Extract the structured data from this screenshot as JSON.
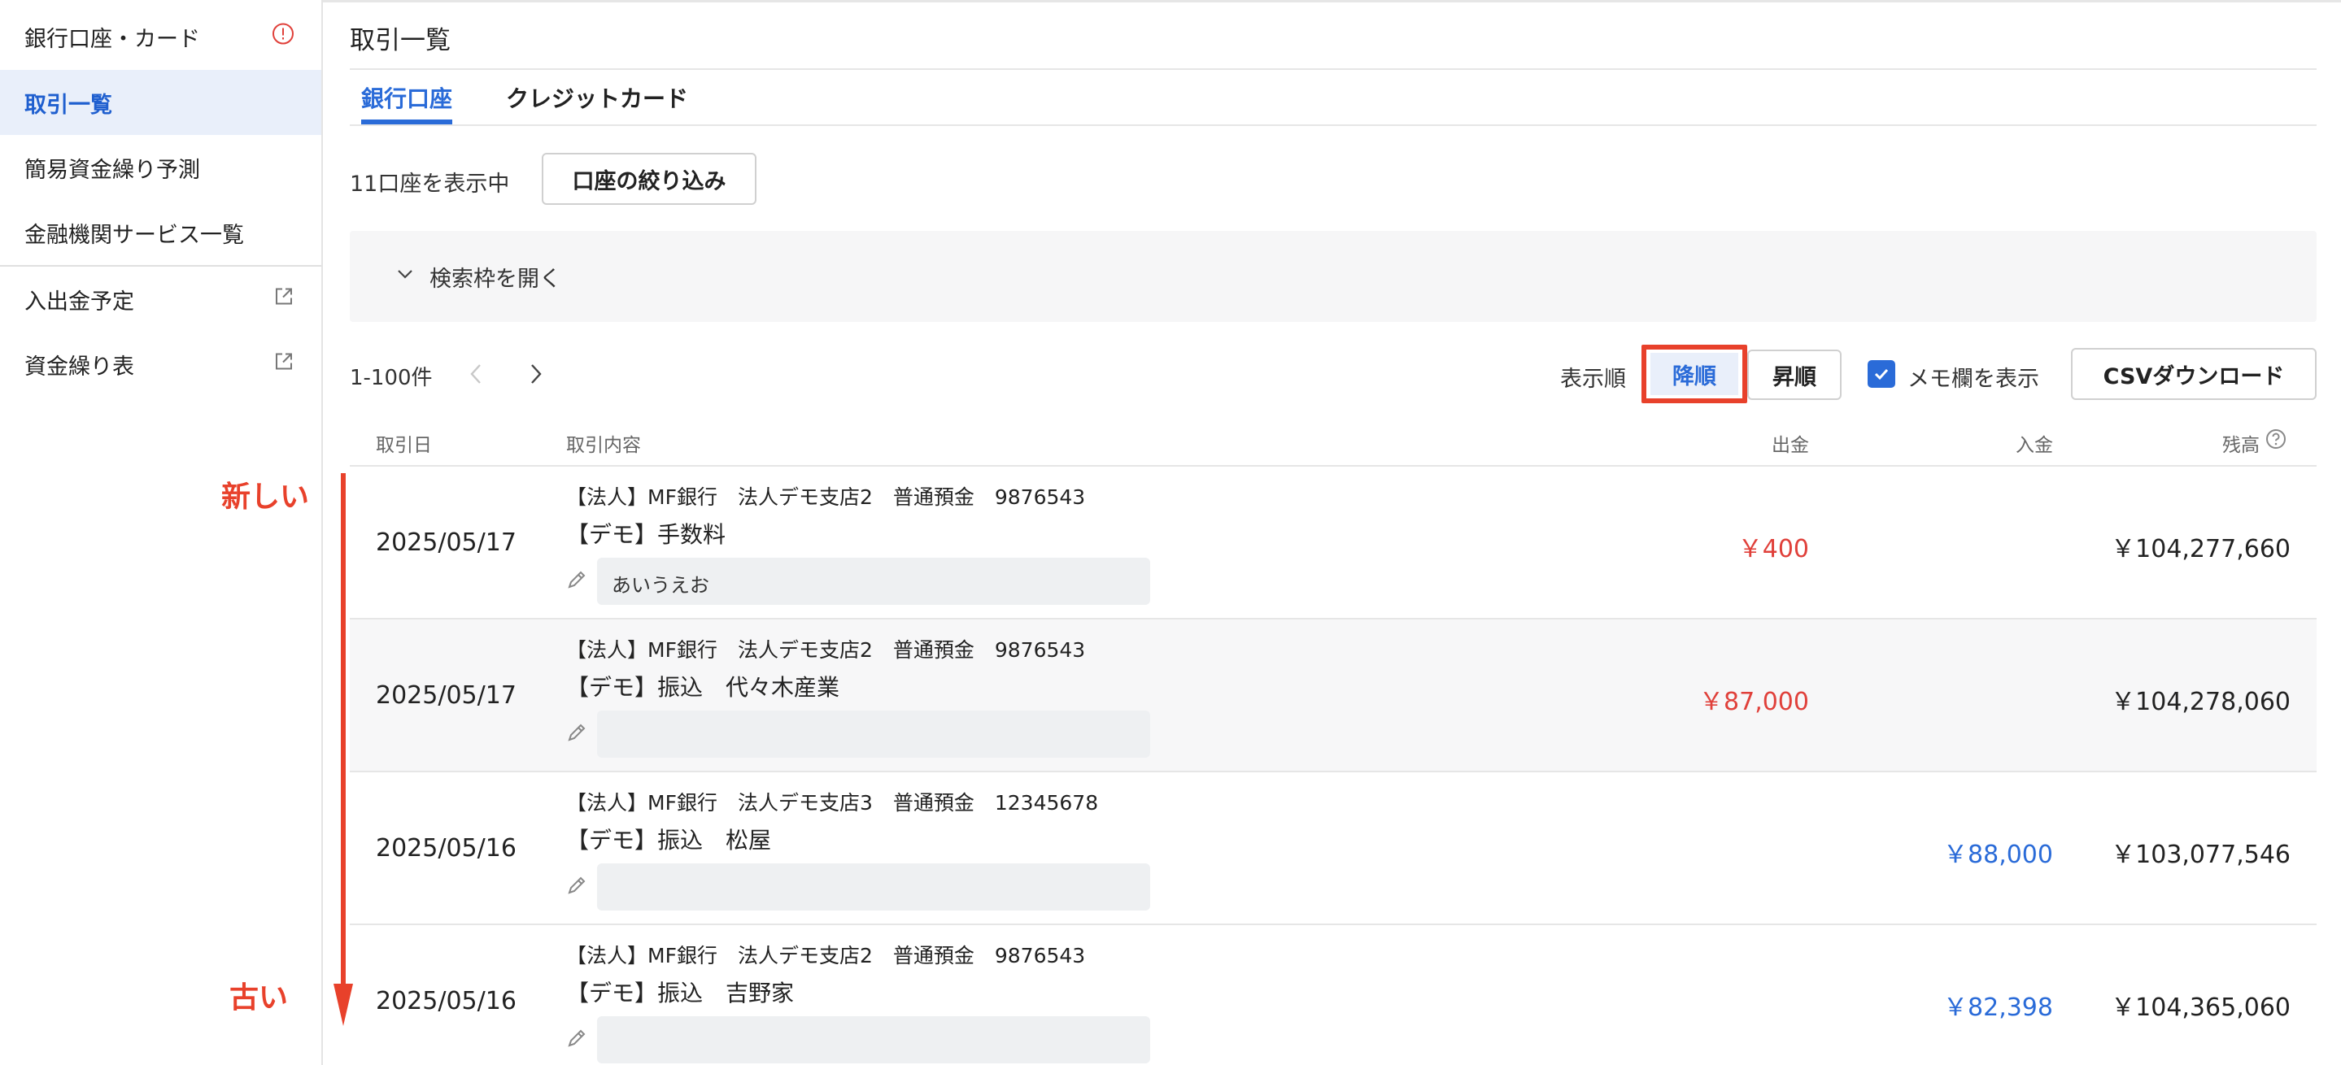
{
  "sidebar": {
    "items": [
      {
        "label": "銀行口座・カード",
        "icon": "alert-circle-icon"
      },
      {
        "label": "取引一覧",
        "active": true
      },
      {
        "label": "簡易資金繰り予測"
      },
      {
        "label": "金融機関サービス一覧"
      },
      {
        "label": "入出金予定",
        "icon": "external-link-icon"
      },
      {
        "label": "資金繰り表",
        "icon": "external-link-icon"
      }
    ]
  },
  "main": {
    "title": "取引一覧",
    "tabs": [
      {
        "label": "銀行口座",
        "active": true
      },
      {
        "label": "クレジットカード",
        "active": false
      }
    ],
    "account_count": "11口座を表示中",
    "filter_button": "口座の絞り込み",
    "search_toggle": "検索枠を開く",
    "pagination": "1-100件",
    "sort": {
      "label": "表示順",
      "desc": "降順",
      "asc": "昇順",
      "selected": "降順"
    },
    "memo_toggle": {
      "label": "メモ欄を表示",
      "checked": true
    },
    "csv_button": "CSVダウンロード",
    "columns": {
      "date": "取引日",
      "content": "取引内容",
      "withdrawal": "出金",
      "deposit": "入金",
      "balance": "残高"
    },
    "rows": [
      {
        "date": "2025/05/17",
        "account": "【法人】MF銀行　法人デモ支店2　普通預金　9876543",
        "description": "【デモ】手数料",
        "memo": "あいうえお",
        "withdrawal": "￥400",
        "deposit": "",
        "balance": "￥104,277,660"
      },
      {
        "date": "2025/05/17",
        "account": "【法人】MF銀行　法人デモ支店2　普通預金　9876543",
        "description": "【デモ】振込　代々木産業",
        "memo": "",
        "withdrawal": "￥87,000",
        "deposit": "",
        "balance": "￥104,278,060"
      },
      {
        "date": "2025/05/16",
        "account": "【法人】MF銀行　法人デモ支店3　普通預金　12345678",
        "description": "【デモ】振込　松屋",
        "memo": "",
        "withdrawal": "",
        "deposit": "￥88,000",
        "balance": "￥103,077,546"
      },
      {
        "date": "2025/05/16",
        "account": "【法人】MF銀行　法人デモ支店2　普通預金　9876543",
        "description": "【デモ】振込　吉野家",
        "memo": "",
        "withdrawal": "",
        "deposit": "￥82,398",
        "balance": "￥104,365,060"
      }
    ]
  },
  "annotations": {
    "newer": "新しい",
    "older": "古い",
    "color": "#e8412b"
  },
  "colors": {
    "accent": "#2a6bd8",
    "withdrawal": "#e0403a",
    "highlight": "#e8412b"
  }
}
